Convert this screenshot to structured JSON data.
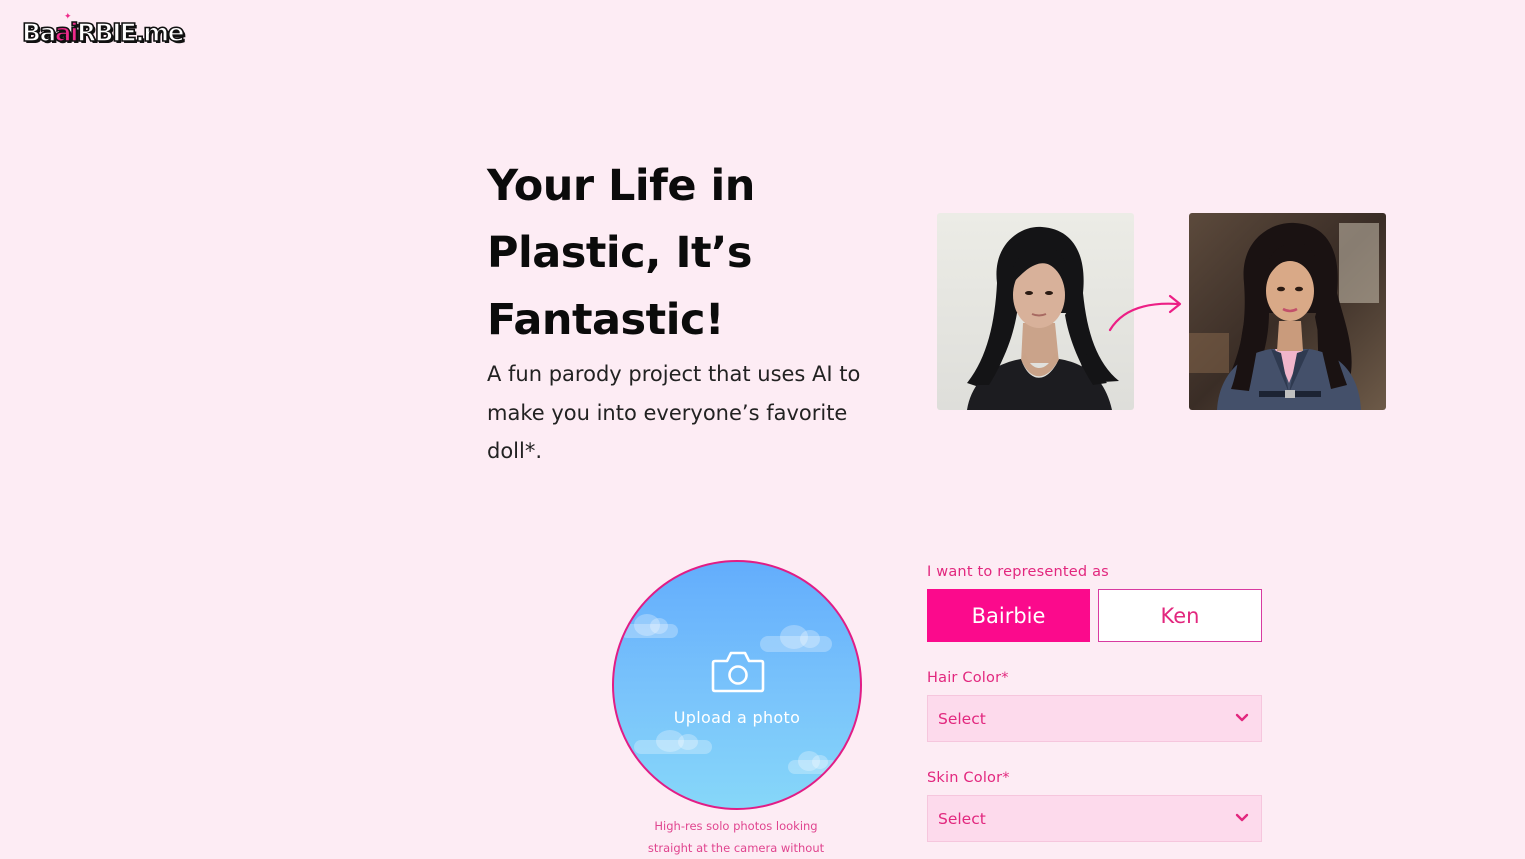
{
  "brand": {
    "logo_part1": "Ba",
    "logo_ai": "ai",
    "logo_part2": "RBIE.me",
    "accent_color": "#fb0a8c",
    "background_color": "#fdecf4"
  },
  "hero": {
    "title": "Your Life in Plastic, It’s Fantastic!",
    "subtitle": "A fun parody project that uses AI to make you into everyone’s favorite doll*."
  },
  "example": {
    "before_image": "woman-portrait",
    "after_image": "doll-portrait",
    "arrow_icon": "curved-arrow-icon"
  },
  "upload": {
    "label": "Upload a photo",
    "icon": "camera-icon",
    "hint": "High-res solo photos looking straight at the camera without"
  },
  "form": {
    "represent_label": "I want to represented as",
    "options": [
      "Bairbie",
      "Ken"
    ],
    "selected": "Bairbie",
    "hair_label": "Hair Color*",
    "hair_value": "Select",
    "skin_label": "Skin Color*",
    "skin_value": "Select"
  }
}
